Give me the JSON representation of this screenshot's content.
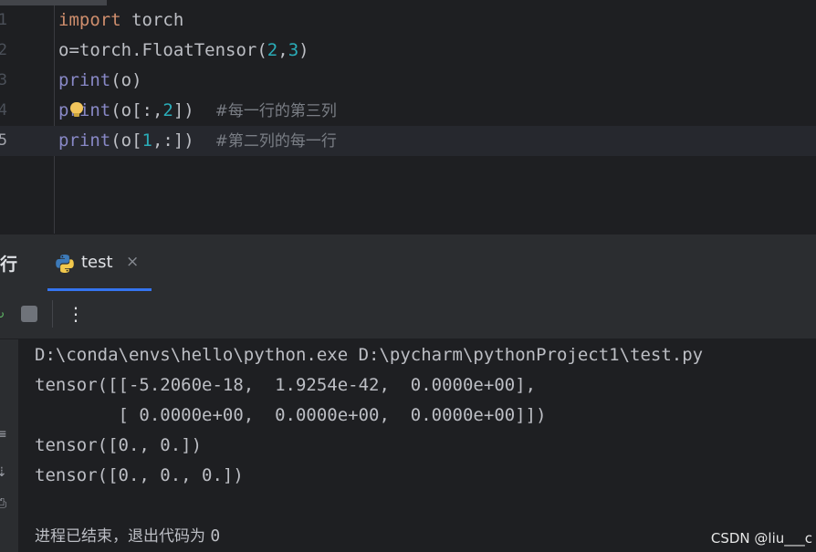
{
  "editor": {
    "line_numbers": [
      "1",
      "2",
      "3",
      "4",
      "5"
    ],
    "lines": [
      {
        "t1": "import",
        "t2": " torch"
      },
      {
        "t1": "o=torch.FloatTensor(",
        "t2": "2",
        "t3": ",",
        "t4": "3",
        "t5": ")"
      },
      {
        "t1": "print",
        "t2": "(o)"
      },
      {
        "t1": "print",
        "t2": "(o[:,",
        "t3": "2",
        "t4": "])  ",
        "t5": "#每一行的第三列"
      },
      {
        "t1": "print",
        "t2": "(o[",
        "t3": "1",
        "t4": ",:])  ",
        "t5": "#第二列的每一行"
      }
    ],
    "current_line": 5
  },
  "run_panel": {
    "title": "行",
    "tab_label": "test",
    "tab_close": "×",
    "more_glyph": "⋮"
  },
  "console": {
    "lines": [
      "D:\\conda\\envs\\hello\\python.exe D:\\pycharm\\pythonProject1\\test.py",
      "tensor([[-5.2060e-18,  1.9254e-42,  0.0000e+00],",
      "        [ 0.0000e+00,  0.0000e+00,  0.0000e+00]])",
      "tensor([0., 0.])",
      "tensor([0., 0., 0.])"
    ],
    "exit_text": "进程已结束，退出代码为",
    "exit_code": "0"
  },
  "watermark": "CSDN @liu___c",
  "colors": {
    "background": "#1e1f22",
    "keyword": "#cf8e6d",
    "builtin": "#8888c6",
    "number": "#2aacb8",
    "comment": "#7a7e85",
    "tab_underline": "#3574f0"
  }
}
